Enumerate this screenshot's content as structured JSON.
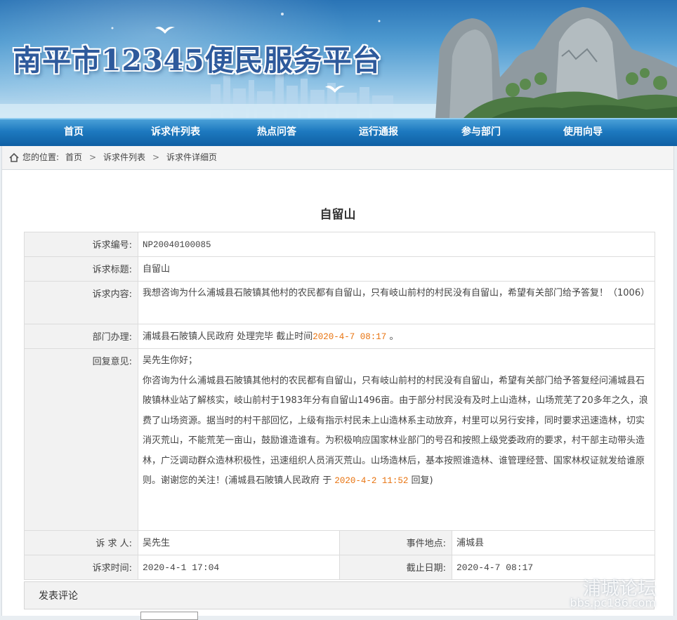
{
  "site": {
    "title": "南平市12345便民服务平台"
  },
  "nav": {
    "items": [
      "首页",
      "诉求件列表",
      "热点问答",
      "运行通报",
      "参与部门",
      "使用向导"
    ]
  },
  "breadcrumb": {
    "label": "您的位置:",
    "items": [
      "首页",
      "诉求件列表",
      "诉求件详细页"
    ],
    "separator": ">"
  },
  "page": {
    "title": "自留山"
  },
  "detail": {
    "number_label": "诉求编号:",
    "number": "NP20040100085",
    "subject_label": "诉求标题:",
    "subject": "自留山",
    "content_label": "诉求内容:",
    "content": "我想咨询为什么浦城县石陂镇其他村的农民都有自留山，只有岐山前村的村民没有自留山，希望有关部门给予答复！（1006）",
    "dept_label": "部门办理:",
    "dept_text": "浦城县石陂镇人民政府 处理完毕 截止时间",
    "dept_deadline": "2020-4-7 08:17",
    "dept_tail": "。",
    "reply_label": "回复意见:",
    "reply_greeting": "吴先生你好；",
    "reply_body": "你咨询为什么浦城县石陂镇其他村的农民都有自留山，只有岐山前村的村民没有自留山，希望有关部门给予答复经问浦城县石陂镇林业站了解核实，岐山前村于1983年分有自留山1496亩。由于部分村民没有及时上山造林，山场荒芜了20多年之久，浪费了山场资源。据当时的村干部回忆，上级有指示村民未上山造林系主动放弃，村里可以另行安排，同时要求迅速造林，切实消灭荒山，不能荒芜一亩山，鼓励谁造谁有。为积极响应国家林业部门的号召和按照上级党委政府的要求，村干部主动带头造林，广泛调动群众造林积极性，迅速组织人员消灭荒山。山场造林后，基本按照谁造林、谁管理经营、国家林权证就发给谁原则。谢谢您的关注！(浦城县石陂镇人民政府 于 ",
    "reply_time": "2020-4-2 11:52",
    "reply_tail": " 回复)",
    "requester_label": "诉 求 人:",
    "requester": "吴先生",
    "location_label": "事件地点:",
    "location": "浦城县",
    "time_label": "诉求时间:",
    "time": "2020-4-1 17:04",
    "deadline_label": "截止日期:",
    "deadline": "2020-4-7 08:17"
  },
  "comment": {
    "header": "发表评论"
  },
  "watermark": {
    "line1": "浦城论坛",
    "line2": "bbs.pc186.com"
  },
  "colors": {
    "nav": "#1d79bf",
    "accent": "#e8730f",
    "title": "#2e5a9c"
  }
}
